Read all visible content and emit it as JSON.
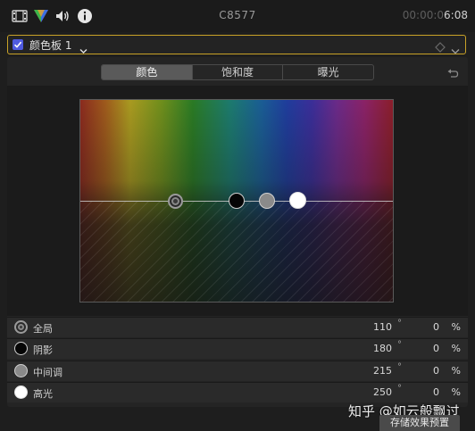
{
  "topbar": {
    "clip_title": "C8577",
    "timecode_dim": "00:00:0",
    "timecode_end": "6:08",
    "icons": [
      "film-icon",
      "color-inspector-icon",
      "audio-icon",
      "info-icon"
    ]
  },
  "board": {
    "name": "颜色板 1",
    "checked": true,
    "accent": "#c9a227",
    "checkbox_color": "#4f5be0"
  },
  "tabs": [
    {
      "label": "颜色",
      "active": true
    },
    {
      "label": "饱和度",
      "active": false
    },
    {
      "label": "曝光",
      "active": false
    }
  ],
  "params": [
    {
      "label": "全局",
      "angle": "110",
      "degree": "°",
      "value": "0",
      "unit": "%",
      "icon": "global-puck-icon"
    },
    {
      "label": "阴影",
      "angle": "180",
      "degree": "°",
      "value": "0",
      "unit": "%",
      "icon": "shadows-puck-icon"
    },
    {
      "label": "中间调",
      "angle": "215",
      "degree": "°",
      "value": "0",
      "unit": "%",
      "icon": "midtones-puck-icon"
    },
    {
      "label": "高光",
      "angle": "250",
      "degree": "°",
      "value": "0",
      "unit": "%",
      "icon": "highlights-puck-icon"
    }
  ],
  "save_button": "存储效果预置",
  "watermark": "知乎 @如云般飘过"
}
